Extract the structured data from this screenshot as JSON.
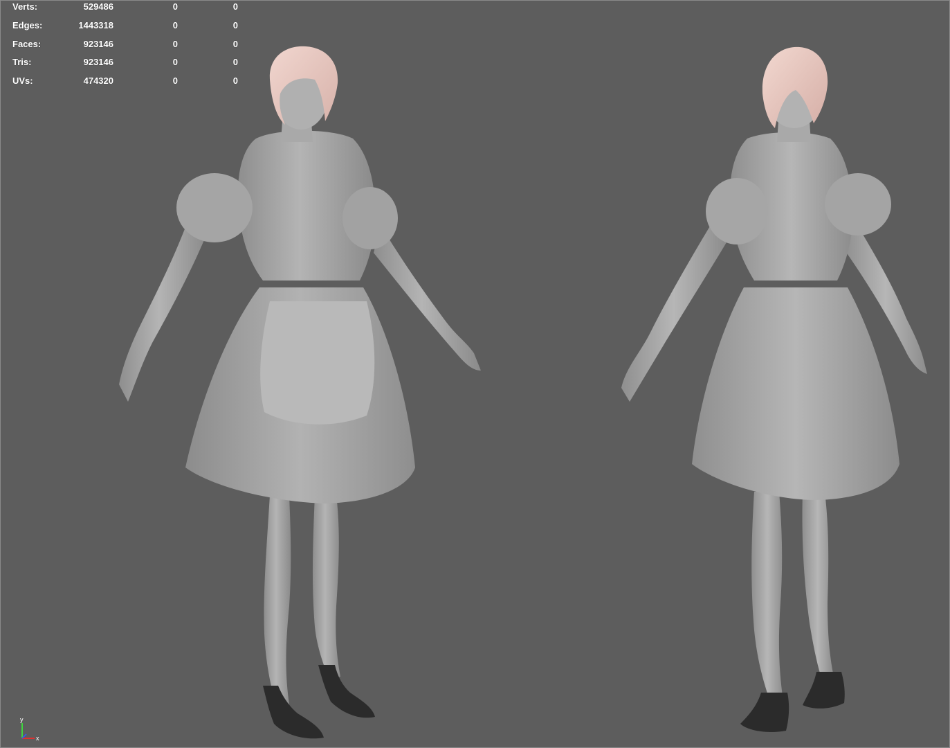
{
  "hud": {
    "rows": [
      {
        "label": "Verts:",
        "v1": "529486",
        "v2": "0",
        "v3": "0"
      },
      {
        "label": "Edges:",
        "v1": "1443318",
        "v2": "0",
        "v3": "0"
      },
      {
        "label": "Faces:",
        "v1": "923146",
        "v2": "0",
        "v3": "0"
      },
      {
        "label": "Tris:",
        "v1": "923146",
        "v2": "0",
        "v3": "0"
      },
      {
        "label": "UVs:",
        "v1": "474320",
        "v2": "0",
        "v3": "0"
      }
    ]
  },
  "gizmo": {
    "y_label": "y",
    "x_label": "x",
    "y_color": "#3fd43f",
    "x_color": "#e03030",
    "z_color": "#3a5be0"
  },
  "colors": {
    "background": "#5d5d5d",
    "model": "#a9a9a9",
    "hair": "#e8c7c0",
    "shoes": "#2b2b2b"
  },
  "models": [
    {
      "name": "character-front-view"
    },
    {
      "name": "character-back-view"
    }
  ]
}
